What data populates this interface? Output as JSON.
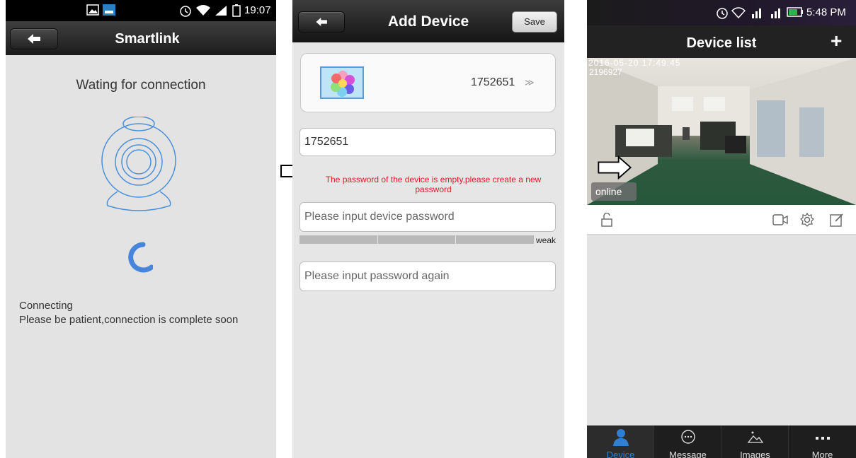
{
  "screen1": {
    "status_time": "19:07",
    "title": "Smartlink",
    "waiting_text": "Wating for connection",
    "connecting_line1": "Connecting",
    "connecting_line2": "Please be patient,connection is complete soon"
  },
  "screen2": {
    "title": "Add Device",
    "save_label": "Save",
    "device_id": "1752651",
    "chevron": "≫",
    "id_field_value": "1752651",
    "error_text": "The password of the device is empty,please create a new password",
    "password_placeholder": "Please input device password",
    "strength_label": "weak",
    "password2_placeholder": "Please input password again"
  },
  "screen3": {
    "status_time": "5:48 PM",
    "title": "Device list",
    "add_symbol": "+",
    "video_timestamp": "2016-05-20  17:49:45",
    "device_id": "2196927",
    "status_badge": "online",
    "tabs": [
      {
        "label": "Device",
        "icon": "person-icon"
      },
      {
        "label": "Message",
        "icon": "message-icon"
      },
      {
        "label": "Images",
        "icon": "image-icon"
      },
      {
        "label": "More",
        "icon": "more-icon"
      }
    ]
  },
  "colors": {
    "error": "#e0192a",
    "accent_blue": "#2f7fd4",
    "camera_line": "#4a90d9"
  }
}
